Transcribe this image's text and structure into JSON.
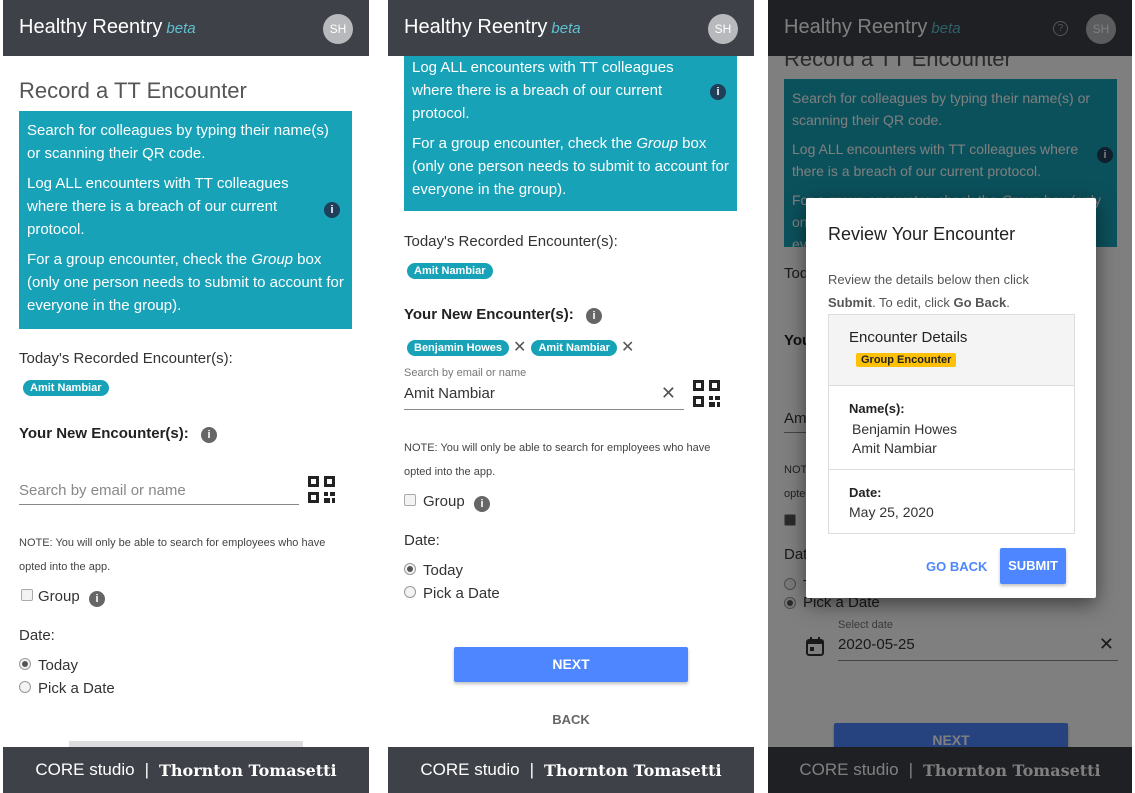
{
  "brand": {
    "name": "Healthy Reentry",
    "beta": "beta",
    "avatar_initials": "SH",
    "help_glyph": "?"
  },
  "footer": {
    "core": "CORE studio",
    "separator": "|",
    "company": "Thornton Tomasetti"
  },
  "colors": {
    "header_bg": "#3f4149",
    "info_bg": "#17a2b8",
    "accent": "#4d86ff",
    "badge": "#ffc107"
  },
  "form": {
    "title": "Record a TT Encounter",
    "info_search": "Search for colleagues by typing their name(s) or scanning their QR code.",
    "info_log": "Log ALL encounters with TT colleagues where there is a breach of our current protocol.",
    "info_group_pre": "For a group encounter, check the ",
    "info_group_em": "Group",
    "info_group_post": " box (only one person needs to submit to account for everyone in the group).",
    "todays_label": "Today's Recorded Encounter(s):",
    "todays_chip": "Amit Nambiar",
    "new_label": "Your New Encounter(s):",
    "search_placeholder": "Search by email or name",
    "note": "NOTE: You will only be able to search for employees who have opted into the app.",
    "group_label": "Group",
    "date_label": "Date:",
    "date_option_today": "Today",
    "date_option_pick": "Pick a Date",
    "next_button": "NEXT",
    "back_button": "BACK"
  },
  "screen2": {
    "new_chips": [
      "Benjamin Howes",
      "Amit Nambiar"
    ],
    "search_small_label": "Search by email or name",
    "search_value": "Amit Nambiar"
  },
  "screen3": {
    "select_date_label": "Select date",
    "date_value": "2020-05-25",
    "modal": {
      "title": "Review Your Encounter",
      "desc_pre": "Review the details below then click ",
      "desc_submit": "Submit",
      "desc_mid": ". To edit, click ",
      "desc_back": "Go Back",
      "desc_end": ".",
      "card_title": "Encounter Details",
      "card_badge": "Group Encounter",
      "names_label": "Name(s):",
      "names": [
        "Benjamin Howes",
        "Amit Nambiar"
      ],
      "date_label": "Date:",
      "date_value": "May 25, 2020",
      "go_back": "GO BACK",
      "submit": "SUBMIT"
    }
  }
}
